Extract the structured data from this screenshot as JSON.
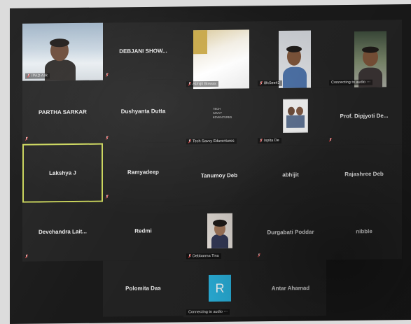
{
  "participants": [
    {
      "name": "IPAD AIR",
      "label": "IPAD AIR"
    },
    {
      "name": "DEBJANI  SHOW..."
    },
    {
      "name": "Abhijit Biswas",
      "label": "Abhijit Biswas"
    },
    {
      "name": "8fc5ee42",
      "label": "8fc5ee42"
    },
    {
      "name": "Connecting to audio",
      "label": "Connecting to audio ⋯"
    },
    {
      "name": "PARTHA SARKAR"
    },
    {
      "name": "Dushyanta Dutta"
    },
    {
      "name": "Tech Savvy Edurentures",
      "label": "Tech Savvy Edurentures",
      "logo_lines": [
        "TECH",
        "SAVVY",
        "EDVENTURES"
      ]
    },
    {
      "name": "Ispita De",
      "label": "Ispita De"
    },
    {
      "name": "Prof. Dipjyoti De..."
    },
    {
      "name": "Lakshya J"
    },
    {
      "name": "Ramyadeep"
    },
    {
      "name": "Tanumoy Deb"
    },
    {
      "name": "abhijit"
    },
    {
      "name": "Rajashree Deb"
    },
    {
      "name": "Devchandra  Lait..."
    },
    {
      "name": "Redmi"
    },
    {
      "name": "Debbarma Tina",
      "label": "Debbarma Tina"
    },
    {
      "name": "Durgabati Poddar"
    },
    {
      "name": "nibble"
    },
    {
      "name": "Polomita Das"
    },
    {
      "name": "Connecting to audio",
      "label": "Connecting to audio ⋯",
      "avatar_letter": "R"
    },
    {
      "name": "Antar Ahamad"
    }
  ],
  "colors": {
    "active_speaker_border": "#c9d45a",
    "avatar_bg": "#2ab2dd",
    "muted_icon": "#e03b3b"
  }
}
